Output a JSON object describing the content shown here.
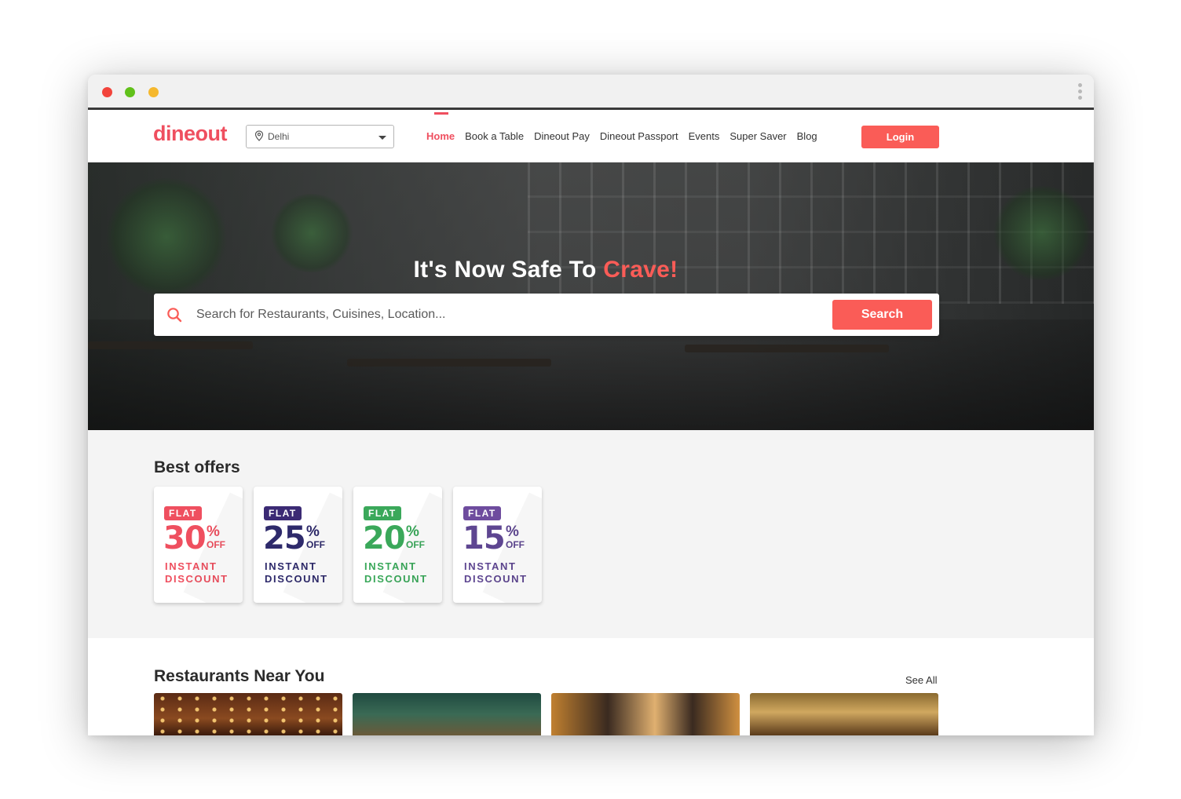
{
  "browser": {
    "window_controls": [
      "close",
      "minimize",
      "maximize"
    ],
    "menu_icon": "kebab-menu-icon"
  },
  "navbar": {
    "logo": "dineout",
    "city": "Delhi",
    "links": [
      {
        "label": "Home",
        "active": true
      },
      {
        "label": "Book a Table",
        "active": false
      },
      {
        "label": "Dineout Pay",
        "active": false
      },
      {
        "label": "Dineout Passport",
        "active": false
      },
      {
        "label": "Events",
        "active": false
      },
      {
        "label": "Super Saver",
        "active": false
      },
      {
        "label": "Blog",
        "active": false
      }
    ],
    "login_label": "Login"
  },
  "hero": {
    "title_main": "It's Now Safe To ",
    "title_accent": "Crave!",
    "search_placeholder": "Search for Restaurants, Cuisines, Location...",
    "search_button": "Search"
  },
  "offers": {
    "title": "Best offers",
    "cards": [
      {
        "flat": "FLAT",
        "percent": "30",
        "sign": "%",
        "off": "OFF",
        "line1": "INSTANT",
        "line2": "DISCOUNT",
        "badge_color": "#ef4f5f",
        "color": "#ef4f5f"
      },
      {
        "flat": "FLAT",
        "percent": "25",
        "sign": "%",
        "off": "OFF",
        "line1": "INSTANT",
        "line2": "DISCOUNT",
        "badge_color": "#3b2a74",
        "color": "#2e2a6b"
      },
      {
        "flat": "FLAT",
        "percent": "20",
        "sign": "%",
        "off": "OFF",
        "line1": "INSTANT",
        "line2": "DISCOUNT",
        "badge_color": "#3aa85a",
        "color": "#3aa85a"
      },
      {
        "flat": "FLAT",
        "percent": "15",
        "sign": "%",
        "off": "OFF",
        "line1": "INSTANT",
        "line2": "DISCOUNT",
        "badge_color": "#6e4c9e",
        "color": "#5e4691"
      }
    ]
  },
  "nearby": {
    "title": "Restaurants Near You",
    "see_all": "See All"
  },
  "colors": {
    "brand": "#ef4f5f",
    "button": "#fa5c57",
    "offers_bg": "#f4f4f4"
  }
}
